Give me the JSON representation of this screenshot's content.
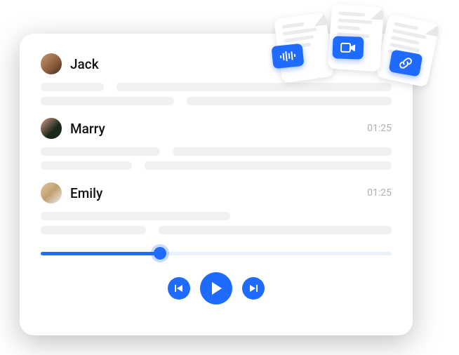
{
  "entries": [
    {
      "name": "Jack",
      "time": ""
    },
    {
      "name": "Marry",
      "time": "01:25"
    },
    {
      "name": "Emily",
      "time": "01:25"
    }
  ],
  "badges": [
    "audio-wave-icon",
    "video-icon",
    "link-icon"
  ],
  "colors": {
    "accent": "#1f6bff",
    "skeleton": "#f1f1f1"
  },
  "progress_percent": 34
}
